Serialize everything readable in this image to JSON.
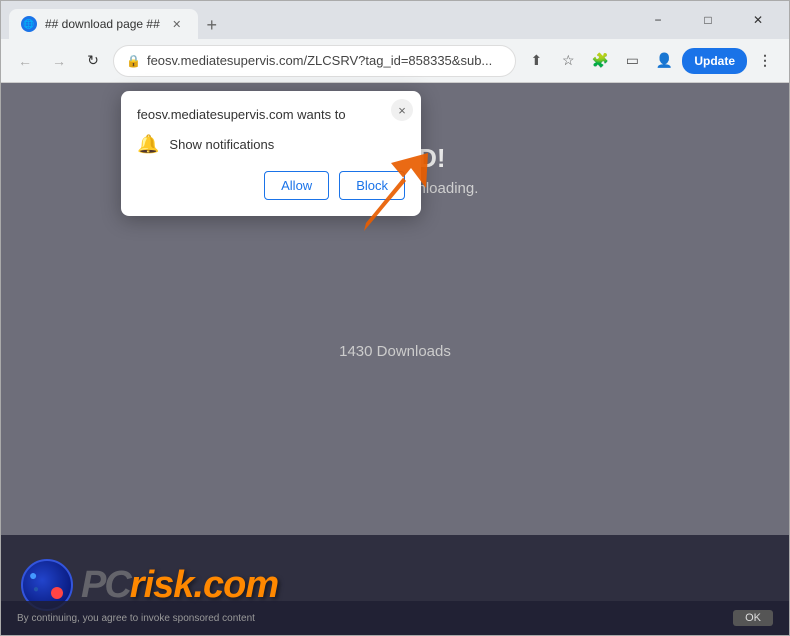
{
  "browser": {
    "tab": {
      "title": "## download page ##",
      "favicon": "🌐"
    },
    "new_tab_label": "+",
    "controls": {
      "minimize": "−",
      "maximize": "□",
      "close": "✕"
    },
    "nav": {
      "back": "←",
      "forward": "→",
      "refresh": "↻"
    },
    "address": "feosv.mediatesupervis.com/ZLCSRV?tag_id=858335&sub...",
    "address_icons": {
      "lock": "🔒",
      "share": "⬆",
      "bookmark": "☆",
      "extensions": "🧩",
      "sidebar": "▭",
      "profile": "👤"
    },
    "update_button": "Update",
    "menu_dots": "⋮"
  },
  "popup": {
    "header": "feosv.mediatesupervis.com wants to",
    "notification_label": "Show notifications",
    "allow_button": "Allow",
    "block_button": "Block",
    "close": "×"
  },
  "page": {
    "download_title": "NLOAD!",
    "download_subtitle": "ons to start downloading.",
    "download_count": "1430 Downloads"
  },
  "footer": {
    "left_text": "By continuing, you agree to invoke sponsored content",
    "ok_button": "OK"
  },
  "pcrisk": {
    "letters": "PC",
    "text": "risk.com"
  }
}
